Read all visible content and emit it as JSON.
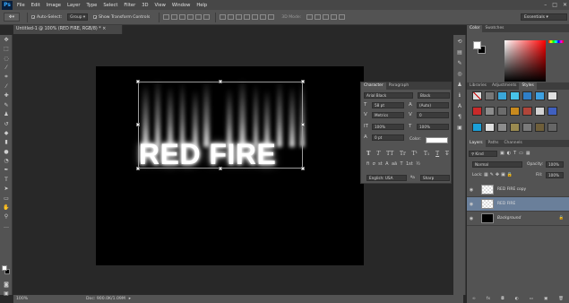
{
  "app": {
    "logo": "Ps"
  },
  "menu": [
    "File",
    "Edit",
    "Image",
    "Layer",
    "Type",
    "Select",
    "Filter",
    "3D",
    "View",
    "Window",
    "Help"
  ],
  "window_controls": {
    "minimize": "–",
    "maximize": "□",
    "close": "✕"
  },
  "options": {
    "auto_select_label": "Auto-Select:",
    "auto_select_value": "Group",
    "show_transform_label": "Show Transform Controls",
    "mode_label": "3D Mode:",
    "workspace": "Essentials"
  },
  "document": {
    "tab_title": "Untitled-1 @ 100% (RED FIRE, RGB/8) *",
    "tab_close": "×",
    "canvas_text": "RED FIRE",
    "zoom": "100%",
    "doc_info": "Doc: 900.0K/1.09M"
  },
  "character_panel": {
    "tabs": [
      "Character",
      "Paragraph"
    ],
    "font_family": "Arial Black",
    "font_style": "Black",
    "font_size": "58 pt",
    "leading": "(Auto)",
    "kerning": "Metrics",
    "tracking": "0",
    "vertical_scale": "100%",
    "horizontal_scale": "100%",
    "baseline_shift": "0 pt",
    "color_label": "Color:",
    "language": "English: USA",
    "aa_label": "ªa",
    "anti_alias": "Sharp",
    "type_style_buttons": [
      "T",
      "T",
      "TT",
      "Tr",
      "T¹",
      "T₁",
      "T",
      "T̶"
    ],
    "opentype_buttons": [
      "fi",
      "σ",
      "st",
      "A",
      "aā",
      "T",
      "1st",
      "½"
    ]
  },
  "color_panel": {
    "tabs": [
      "Color",
      "Swatches"
    ]
  },
  "styles_panel": {
    "tabs": [
      "Libraries",
      "Adjustments",
      "Styles"
    ]
  },
  "layers_panel": {
    "tabs": [
      "Layers",
      "Paths",
      "Channels"
    ],
    "kind_filter": "Kind",
    "blend_mode": "Normal",
    "opacity_label": "Opacity:",
    "opacity_value": "100%",
    "lock_label": "Lock:",
    "fill_label": "Fill:",
    "fill_value": "100%",
    "layers": [
      {
        "name": "RED FIRE copy",
        "selected": false
      },
      {
        "name": "RED FIRE",
        "selected": true
      },
      {
        "name": "Background",
        "selected": false
      }
    ],
    "bottom_icons": [
      "link-icon",
      "fx-icon",
      "mask-icon",
      "adjustment-icon",
      "folder-icon",
      "new-layer-icon",
      "trash-icon"
    ],
    "bottom_glyphs": [
      "∞",
      "fx",
      "◘",
      "◐",
      "▭",
      "▣",
      "🗑"
    ]
  },
  "colors": {
    "selected_layer": "#6a7f9a",
    "panel": "#535353",
    "menubar": "#474747",
    "workspace_bg": "#282828"
  }
}
